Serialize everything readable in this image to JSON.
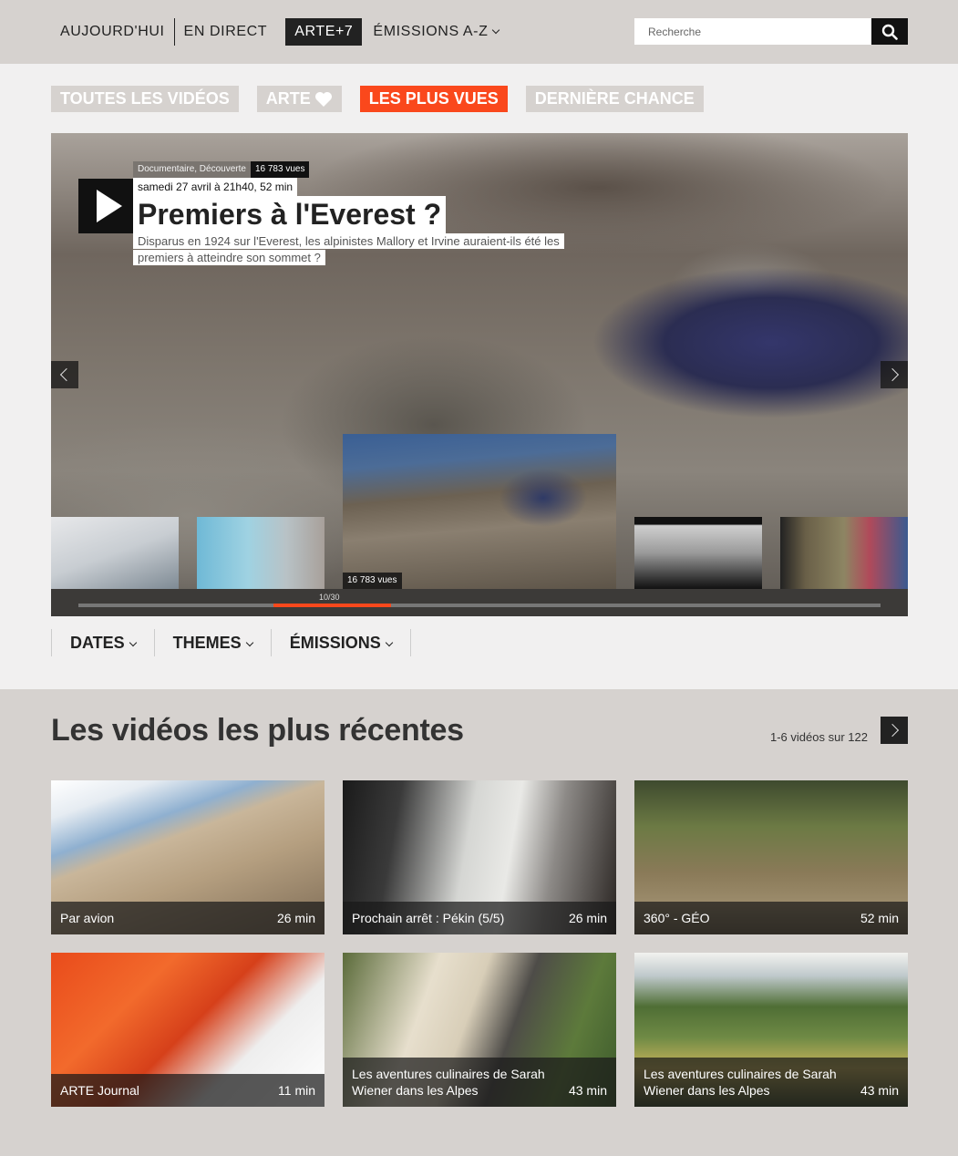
{
  "nav": {
    "items": [
      {
        "label": "AUJOURD'HUI"
      },
      {
        "label": "EN DIRECT"
      },
      {
        "label": "ARTE+7"
      },
      {
        "label": "ÉMISSIONS A-Z"
      }
    ],
    "active_index": 2
  },
  "search": {
    "placeholder": "Recherche"
  },
  "filters": [
    {
      "label": "TOUTES LES VIDÉOS",
      "active": false
    },
    {
      "label": "ARTE",
      "active": false
    },
    {
      "label": "LES PLUS VUES",
      "active": true
    },
    {
      "label": "DERNIÈRE CHANCE",
      "active": false
    }
  ],
  "hero": {
    "category": "Documentaire, Découverte",
    "views": "16 783 vues",
    "date": "samedi 27 avril à 21h40, 52 min",
    "title": "Premiers à l'Everest ?",
    "description": "Disparus en 1924 sur l'Everest, les alpinistes Mallory et Irvine auraient-ils été les premiers à atteindre son sommet ?",
    "selected_thumb_views": "16 783 vues",
    "counter": "10/30",
    "progress": {
      "current": 10,
      "total": 30
    }
  },
  "menus": [
    {
      "label": "DATES"
    },
    {
      "label": "THEMES"
    },
    {
      "label": "ÉMISSIONS"
    }
  ],
  "recent": {
    "title": "Les vidéos les plus récentes",
    "count": "1-6 vidéos sur 122",
    "videos": [
      {
        "title": "Par avion",
        "duration": "26 min"
      },
      {
        "title": "Prochain arrêt : Pékin (5/5)",
        "duration": "26 min"
      },
      {
        "title": "360° - GÉO",
        "duration": "52 min"
      },
      {
        "title": "ARTE Journal",
        "duration": "11 min"
      },
      {
        "title": "Les aventures culinaires de Sarah Wiener dans les Alpes",
        "duration": "43 min"
      },
      {
        "title": "Les aventures culinaires de Sarah Wiener dans les Alpes",
        "duration": "43 min"
      }
    ]
  },
  "colors": {
    "accent": "#fa481c",
    "dark": "#222222",
    "bg": "#d6d2cf"
  }
}
